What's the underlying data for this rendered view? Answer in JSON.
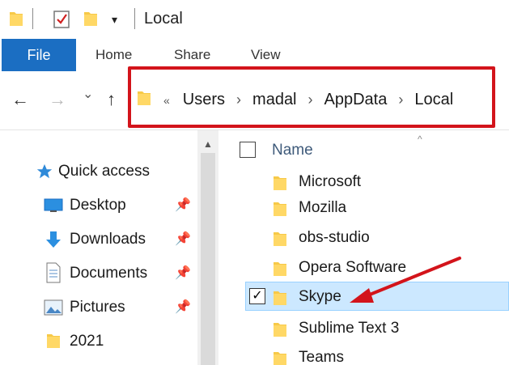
{
  "window": {
    "title": "Local"
  },
  "quick_access_toolbar": {
    "dropdown_glyph": "▾"
  },
  "ribbon": {
    "tabs": [
      "File",
      "Home",
      "Share",
      "View"
    ]
  },
  "navigation": {
    "back_glyph": "←",
    "forward_glyph": "→",
    "recent_glyph": "⌄",
    "up_glyph": "↑"
  },
  "address_bar": {
    "overflow_glyph": "«",
    "separator": "›",
    "crumbs": [
      "Users",
      "madal",
      "AppData",
      "Local"
    ]
  },
  "nav_pane": {
    "items": [
      {
        "label": "Quick access",
        "icon": "star-icon"
      },
      {
        "label": "Desktop",
        "icon": "desktop-icon",
        "pinned": true
      },
      {
        "label": "Downloads",
        "icon": "download-icon",
        "pinned": true
      },
      {
        "label": "Documents",
        "icon": "documents-icon",
        "pinned": true
      },
      {
        "label": "Pictures",
        "icon": "pictures-icon",
        "pinned": true
      },
      {
        "label": "2021",
        "icon": "folder-icon"
      }
    ],
    "pin_glyph": "📌"
  },
  "file_list": {
    "column_name": "Name",
    "sort_glyph": "^",
    "items": [
      {
        "name": "Microsoft"
      },
      {
        "name": "Mozilla"
      },
      {
        "name": "obs-studio"
      },
      {
        "name": "Opera Software"
      },
      {
        "name": "Skype",
        "selected": true
      },
      {
        "name": "Sublime Text 3"
      },
      {
        "name": "Teams"
      }
    ],
    "check_glyph": "✓"
  },
  "colors": {
    "file_tab": "#1b6ec2",
    "highlight_box": "#d3141b",
    "selection_bg": "#cce8ff",
    "folder": "#f7c948",
    "annotation_arrow": "#d3141b"
  }
}
